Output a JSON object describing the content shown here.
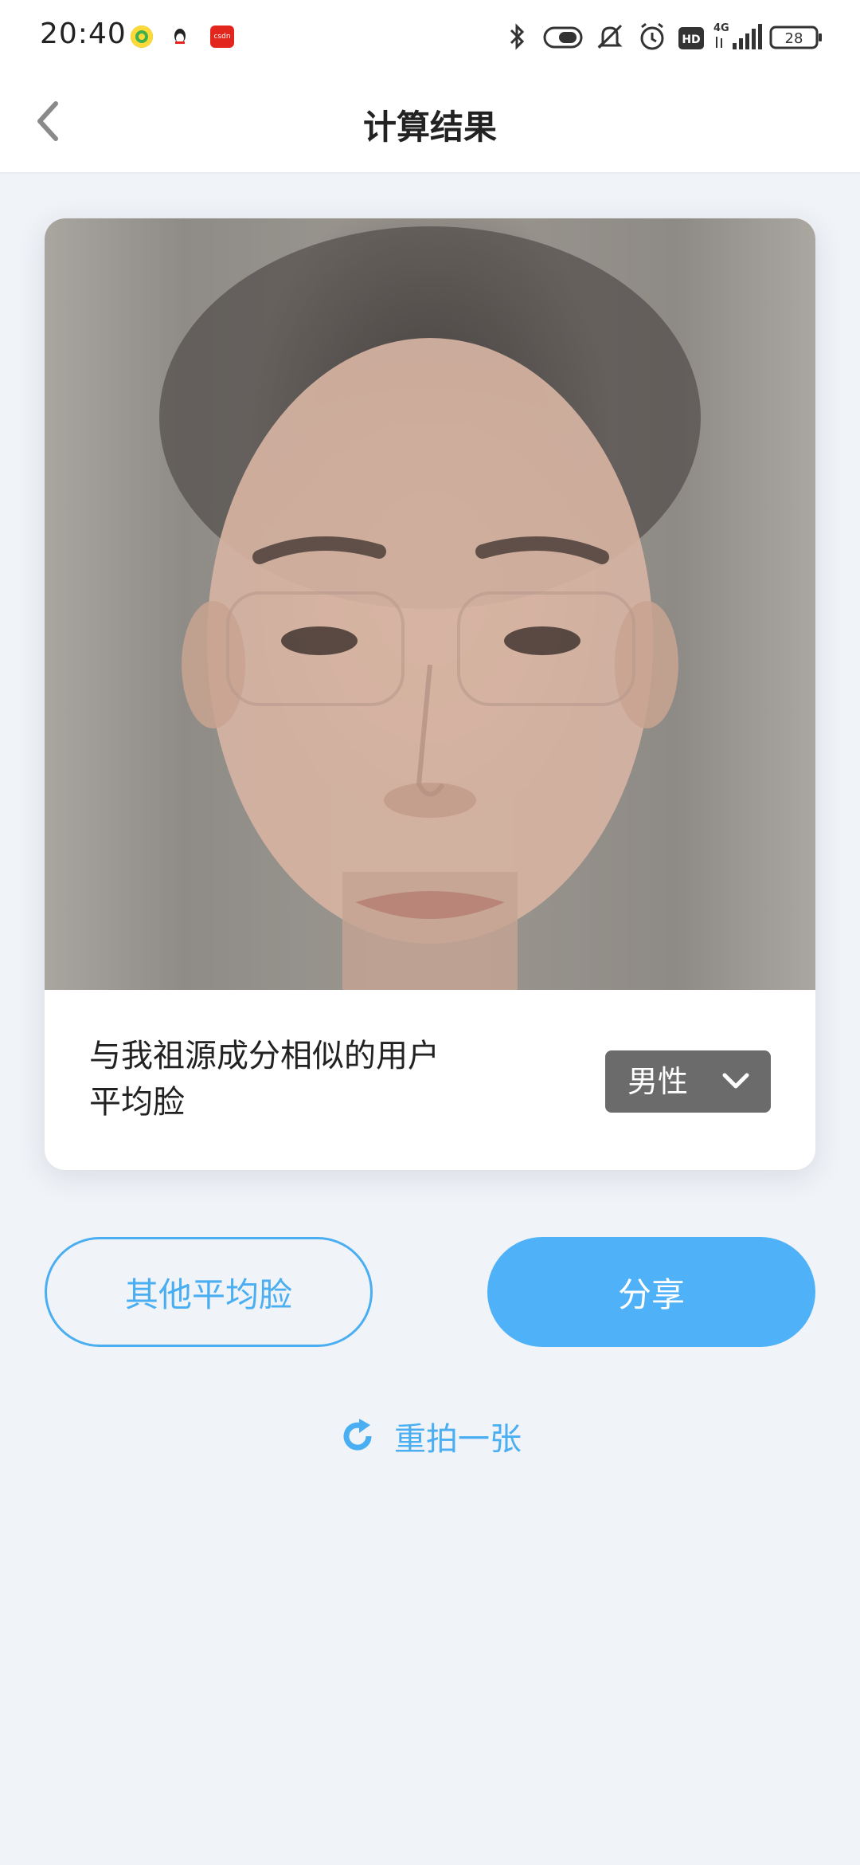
{
  "status_bar": {
    "time": "20:40",
    "battery": "28",
    "network": "4G",
    "hd_label": "HD",
    "notification_icons": [
      "app-notification-icon",
      "qq-icon",
      "csdn-icon"
    ],
    "system_icons": [
      "bluetooth-icon",
      "toggle-icon",
      "mute-icon",
      "alarm-icon",
      "hd-icon",
      "signal-icon",
      "battery-icon"
    ]
  },
  "header": {
    "title": "计算结果",
    "back_icon": "chevron-left-icon"
  },
  "result_card": {
    "caption": "与我祖源成分相似的用户平均脸",
    "gender_selected": "男性",
    "dropdown_icon": "chevron-down-icon"
  },
  "actions": {
    "other_faces_label": "其他平均脸",
    "share_label": "分享",
    "retake_label": "重拍一张",
    "retake_icon": "refresh-icon"
  },
  "colors": {
    "accent": "#4fb1f7",
    "background": "#f0f3f7",
    "select_bg": "#6b6b6b"
  }
}
